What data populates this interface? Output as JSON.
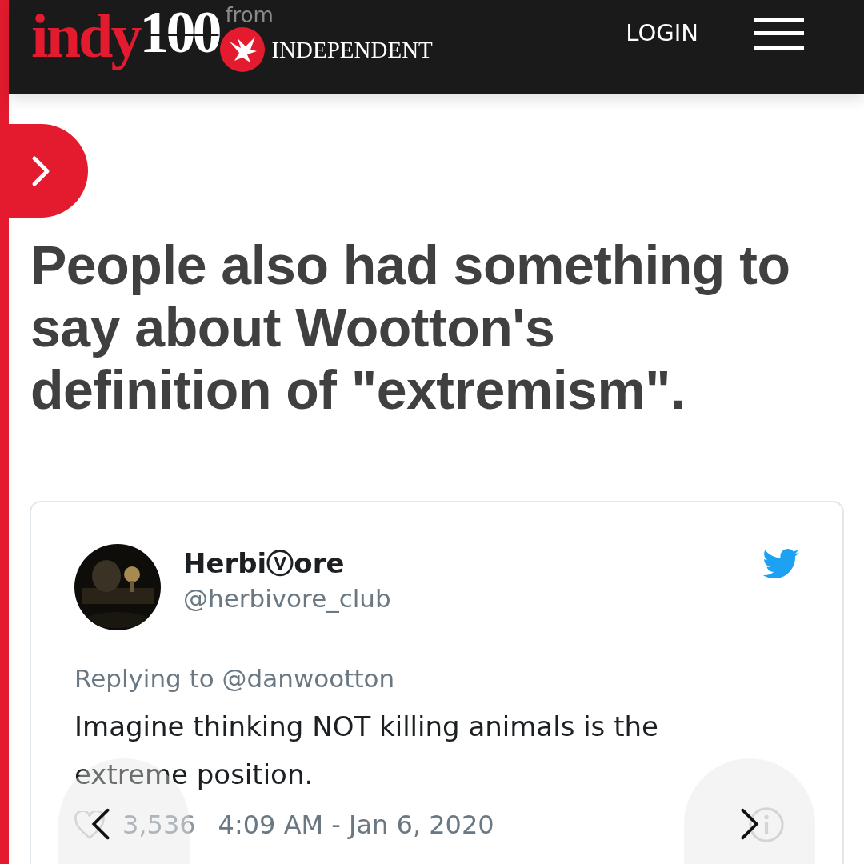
{
  "header": {
    "logo_word": "indy",
    "logo_number": "100",
    "from": "from",
    "publisher": "INDEPENDENT",
    "login": "LOGIN"
  },
  "headline": "People also had something to say about Wootton's definition of \"extremism\".",
  "tweet": {
    "name": "Herbiⓥore",
    "handle": "@herbivore_club",
    "replying_to": "Replying to @danwootton",
    "text": "Imagine thinking NOT killing animals is the extreme position.",
    "likes": "3,536",
    "timestamp": "4:09 AM - Jan 6, 2020"
  }
}
